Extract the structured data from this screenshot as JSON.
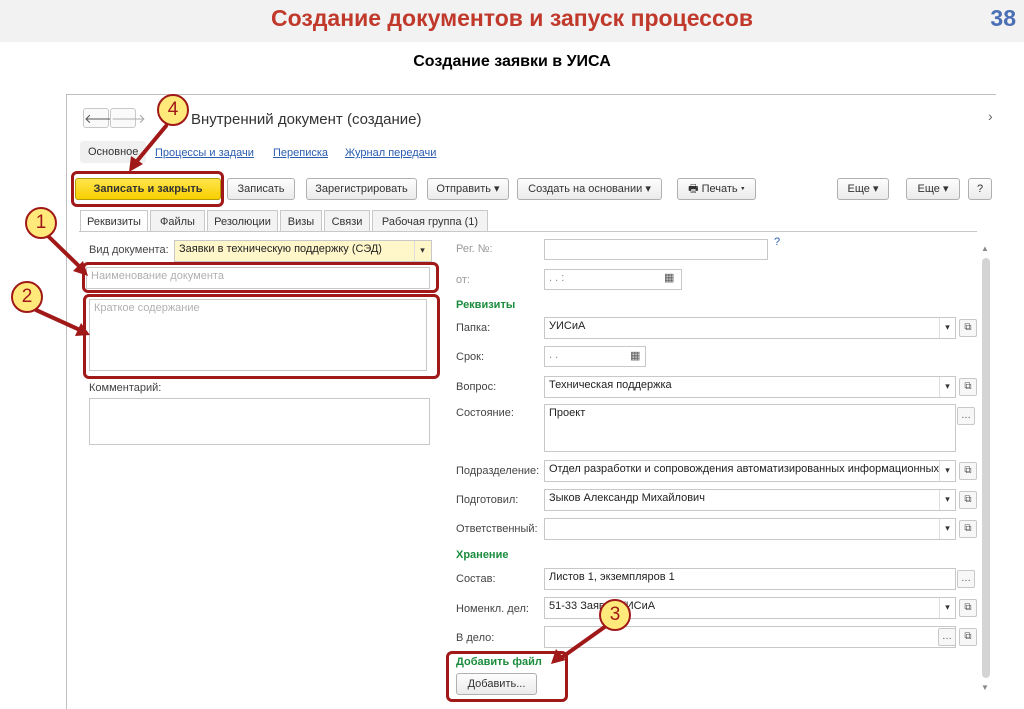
{
  "slide": {
    "title": "Создание документов и запуск процессов",
    "page": "38",
    "subtitle": "Создание заявки в УИСА"
  },
  "window": {
    "title": "Внутренний документ (создание)",
    "tabs": [
      "Основное",
      "Процессы и задачи",
      "Переписка",
      "Журнал передачи"
    ]
  },
  "toolbar": {
    "save_close": "Записать и закрыть",
    "save": "Записать",
    "register": "Зарегистрировать",
    "send": "Отправить",
    "create_based": "Создать на основании",
    "print": "Печать",
    "more1": "Еще",
    "more2": "Еще",
    "help": "?"
  },
  "subtabs": [
    "Реквизиты",
    "Файлы",
    "Резолюции",
    "Визы",
    "Связи",
    "Рабочая группа (1)"
  ],
  "left": {
    "doc_type_label": "Вид документа:",
    "doc_type_value": "Заявки в техническую поддержку (СЭД)",
    "name_placeholder": "Наименование документа",
    "summary_placeholder": "Краткое содержание",
    "comment_label": "Комментарий:"
  },
  "right": {
    "reg_label": "Рег. №:",
    "help_mark": "?",
    "from_label": "от:",
    "from_value": ".  .       :",
    "requisites_header": "Реквизиты",
    "folder_label": "Папка:",
    "folder_value": "УИСиА",
    "term_label": "Срок:",
    "term_value": ".  .",
    "question_label": "Вопрос:",
    "question_value": "Техническая поддержка",
    "state_label": "Состояние:",
    "state_value": "Проект",
    "dept_label": "Подразделение:",
    "dept_value": "Отдел разработки и сопровождения автоматизированных информационных",
    "prepared_label": "Подготовил:",
    "prepared_value": "Зыков Александр Михайлович",
    "responsible_label": "Ответственный:",
    "storage_header": "Хранение",
    "composition_label": "Состав:",
    "composition_value": "Листов 1, экземпляров 1",
    "nomencl_label": "Номенкл. дел:",
    "nomencl_value": "51-33 Заявки УИСиА",
    "case_label": "В дело:",
    "add_file_header": "Добавить файл",
    "add_button": "Добавить..."
  },
  "markers": [
    "1",
    "2",
    "3",
    "4"
  ]
}
